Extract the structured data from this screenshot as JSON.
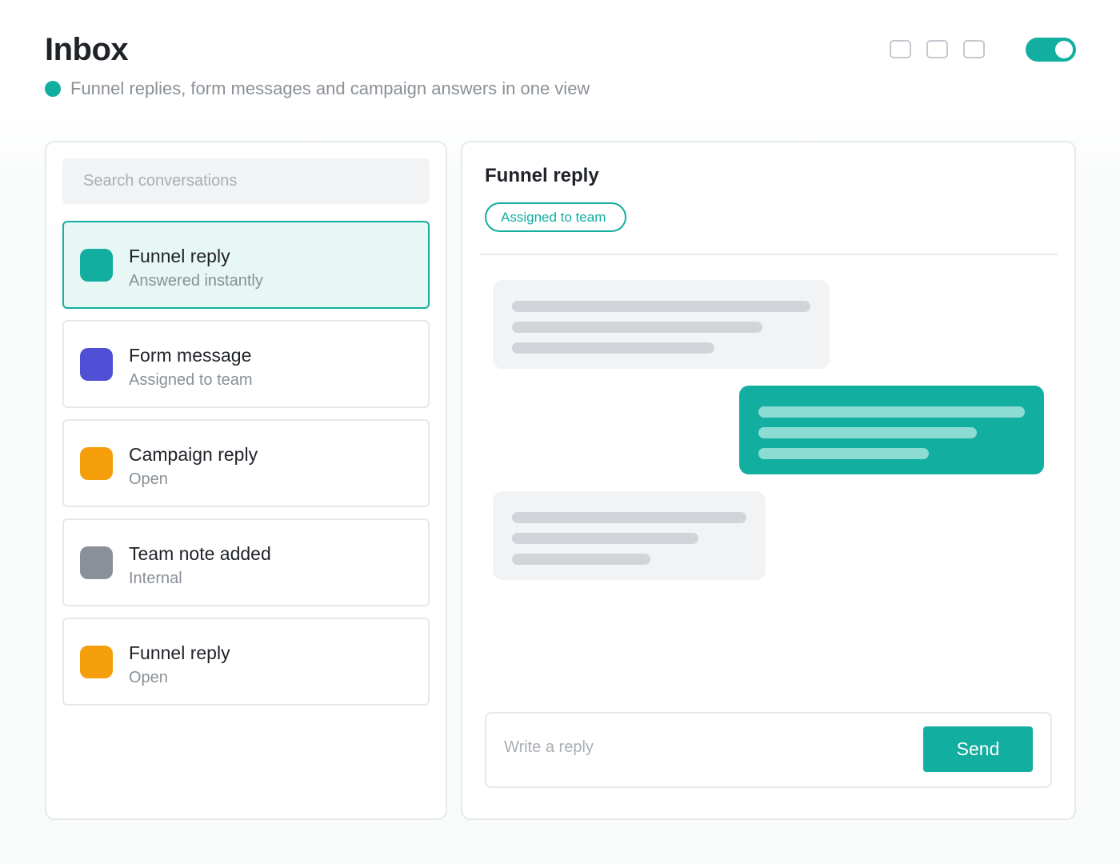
{
  "header": {
    "title": "Inbox",
    "subtitle": "Funnel replies, form messages and campaign answers in one view",
    "status_color": "#12ae9f",
    "window_icons": [
      "square-icon",
      "square-icon",
      "square-icon"
    ],
    "toggle": {
      "on": true,
      "color": "#12ae9f"
    }
  },
  "sidebar": {
    "search_placeholder": "Search conversations",
    "conversations": [
      {
        "title": "Funnel reply",
        "status": "Answered instantly",
        "color": "#12ae9f",
        "active": true
      },
      {
        "title": "Form message",
        "status": "Assigned to team",
        "color": "#4f4fd6",
        "active": false
      },
      {
        "title": "Campaign reply",
        "status": "Open",
        "color": "#f59e0b",
        "active": false
      },
      {
        "title": "Team note added",
        "status": "Internal",
        "color": "#8a9097",
        "active": false
      },
      {
        "title": "Funnel reply",
        "status": "Open",
        "color": "#f59e0b",
        "active": false
      }
    ]
  },
  "thread": {
    "title": "Funnel reply",
    "badge": "Assigned to team",
    "reply_placeholder": "Write a reply",
    "send_label": "Send",
    "accent": "#12ae9f"
  }
}
